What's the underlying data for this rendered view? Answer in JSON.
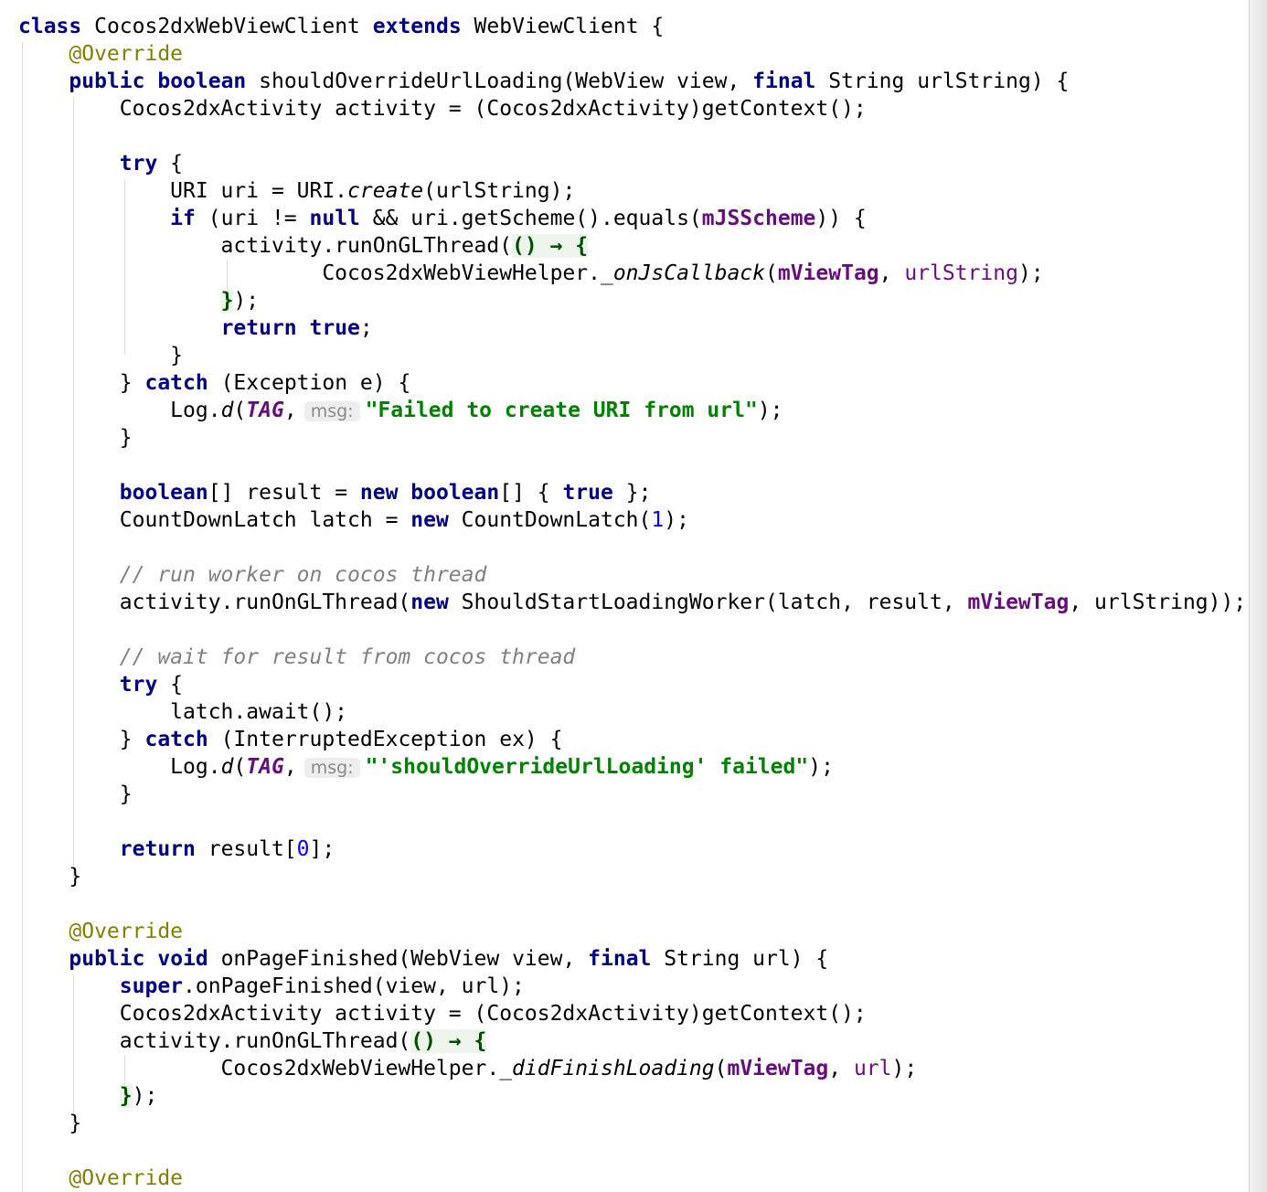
{
  "code_lines": [
    [
      {
        "t": "class",
        "c": "kw"
      },
      {
        "t": " Cocos2dxWebViewClient "
      },
      {
        "t": "extends",
        "c": "kw"
      },
      {
        "t": " WebViewClient {"
      }
    ],
    [
      {
        "t": "    "
      },
      {
        "t": "@Override",
        "c": "ann"
      }
    ],
    [
      {
        "t": "    "
      },
      {
        "t": "public",
        "c": "kw"
      },
      {
        "t": " "
      },
      {
        "t": "boolean",
        "c": "kw"
      },
      {
        "t": " shouldOverrideUrlLoading(WebView view, "
      },
      {
        "t": "final",
        "c": "kw"
      },
      {
        "t": " String urlString) {"
      }
    ],
    [
      {
        "t": "        Cocos2dxActivity activity = (Cocos2dxActivity)getContext();"
      }
    ],
    [],
    [
      {
        "t": "        "
      },
      {
        "t": "try",
        "c": "kw"
      },
      {
        "t": " {"
      }
    ],
    [
      {
        "t": "            URI uri = URI."
      },
      {
        "t": "create",
        "c": "it"
      },
      {
        "t": "(urlString);"
      }
    ],
    [
      {
        "t": "            "
      },
      {
        "t": "if",
        "c": "kw"
      },
      {
        "t": " (uri != "
      },
      {
        "t": "null",
        "c": "kw"
      },
      {
        "t": " && uri.getScheme().equals("
      },
      {
        "t": "mJSScheme",
        "c": "fld"
      },
      {
        "t": ")) {"
      }
    ],
    [
      {
        "t": "                activity.runOnGLThread("
      },
      {
        "t": "() → {",
        "c": "lam"
      }
    ],
    [
      {
        "t": "                        Cocos2dxWebViewHelper."
      },
      {
        "t": "_onJsCallback",
        "c": "it"
      },
      {
        "t": "("
      },
      {
        "t": "mViewTag",
        "c": "fld"
      },
      {
        "t": ", "
      },
      {
        "t": "urlString",
        "c": "param"
      },
      {
        "t": ");"
      }
    ],
    [
      {
        "t": "                "
      },
      {
        "t": "}",
        "c": "lam"
      },
      {
        "t": ");"
      }
    ],
    [
      {
        "t": "                "
      },
      {
        "t": "return",
        "c": "kw"
      },
      {
        "t": " "
      },
      {
        "t": "true",
        "c": "kw"
      },
      {
        "t": ";"
      }
    ],
    [
      {
        "t": "            }"
      }
    ],
    [
      {
        "t": "        } "
      },
      {
        "t": "catch",
        "c": "kw"
      },
      {
        "t": " (Exception e) {"
      }
    ],
    [
      {
        "t": "            Log."
      },
      {
        "t": "d",
        "c": "it"
      },
      {
        "t": "("
      },
      {
        "t": "TAG",
        "c": "sfld"
      },
      {
        "t": ","
      },
      {
        "t": "msg:",
        "c": "hint"
      },
      {
        "t": "\"Failed to create URI from url\"",
        "c": "str"
      },
      {
        "t": ");"
      }
    ],
    [
      {
        "t": "        }"
      }
    ],
    [],
    [
      {
        "t": "        "
      },
      {
        "t": "boolean",
        "c": "kw"
      },
      {
        "t": "[] result = "
      },
      {
        "t": "new",
        "c": "kw"
      },
      {
        "t": " "
      },
      {
        "t": "boolean",
        "c": "kw"
      },
      {
        "t": "[] { "
      },
      {
        "t": "true",
        "c": "kw"
      },
      {
        "t": " };"
      }
    ],
    [
      {
        "t": "        CountDownLatch latch = "
      },
      {
        "t": "new",
        "c": "kw"
      },
      {
        "t": " CountDownLatch("
      },
      {
        "t": "1",
        "c": "num"
      },
      {
        "t": ");"
      }
    ],
    [],
    [
      {
        "t": "        "
      },
      {
        "t": "// run worker on cocos thread",
        "c": "cmt"
      }
    ],
    [
      {
        "t": "        activity.runOnGLThread("
      },
      {
        "t": "new",
        "c": "kw"
      },
      {
        "t": " ShouldStartLoadingWorker(latch, result, "
      },
      {
        "t": "mViewTag",
        "c": "fld"
      },
      {
        "t": ", urlString));"
      }
    ],
    [],
    [
      {
        "t": "        "
      },
      {
        "t": "// wait for result from cocos thread",
        "c": "cmt"
      }
    ],
    [
      {
        "t": "        "
      },
      {
        "t": "try",
        "c": "kw"
      },
      {
        "t": " {"
      }
    ],
    [
      {
        "t": "            latch.await();"
      }
    ],
    [
      {
        "t": "        } "
      },
      {
        "t": "catch",
        "c": "kw"
      },
      {
        "t": " (InterruptedException ex) {"
      }
    ],
    [
      {
        "t": "            Log."
      },
      {
        "t": "d",
        "c": "it"
      },
      {
        "t": "("
      },
      {
        "t": "TAG",
        "c": "sfld"
      },
      {
        "t": ","
      },
      {
        "t": "msg:",
        "c": "hint"
      },
      {
        "t": "\"'shouldOverrideUrlLoading' failed\"",
        "c": "str"
      },
      {
        "t": ");"
      }
    ],
    [
      {
        "t": "        }"
      }
    ],
    [],
    [
      {
        "t": "        "
      },
      {
        "t": "return",
        "c": "kw"
      },
      {
        "t": " result["
      },
      {
        "t": "0",
        "c": "num"
      },
      {
        "t": "];"
      }
    ],
    [
      {
        "t": "    }"
      }
    ],
    [],
    [
      {
        "t": "    "
      },
      {
        "t": "@Override",
        "c": "ann"
      }
    ],
    [
      {
        "t": "    "
      },
      {
        "t": "public",
        "c": "kw"
      },
      {
        "t": " "
      },
      {
        "t": "void",
        "c": "kw"
      },
      {
        "t": " onPageFinished(WebView view, "
      },
      {
        "t": "final",
        "c": "kw"
      },
      {
        "t": " String url) {"
      }
    ],
    [
      {
        "t": "        "
      },
      {
        "t": "super",
        "c": "kw"
      },
      {
        "t": ".onPageFinished(view, url);"
      }
    ],
    [
      {
        "t": "        Cocos2dxActivity activity = (Cocos2dxActivity)getContext();"
      }
    ],
    [
      {
        "t": "        activity.runOnGLThread("
      },
      {
        "t": "() → {",
        "c": "lam"
      }
    ],
    [
      {
        "t": "                Cocos2dxWebViewHelper."
      },
      {
        "t": "_didFinishLoading",
        "c": "it"
      },
      {
        "t": "("
      },
      {
        "t": "mViewTag",
        "c": "fld"
      },
      {
        "t": ", "
      },
      {
        "t": "url",
        "c": "param"
      },
      {
        "t": ");"
      }
    ],
    [
      {
        "t": "        "
      },
      {
        "t": "}",
        "c": "lam"
      },
      {
        "t": ");"
      }
    ],
    [
      {
        "t": "    }"
      }
    ],
    [],
    [
      {
        "t": "    "
      },
      {
        "t": "@Override",
        "c": "ann"
      }
    ]
  ],
  "colors": {
    "keyword": "#000080",
    "annotation": "#808000",
    "field": "#660e7a",
    "string": "#008000",
    "number": "#0000ff",
    "comment": "#808080",
    "background": "#ffffff"
  }
}
